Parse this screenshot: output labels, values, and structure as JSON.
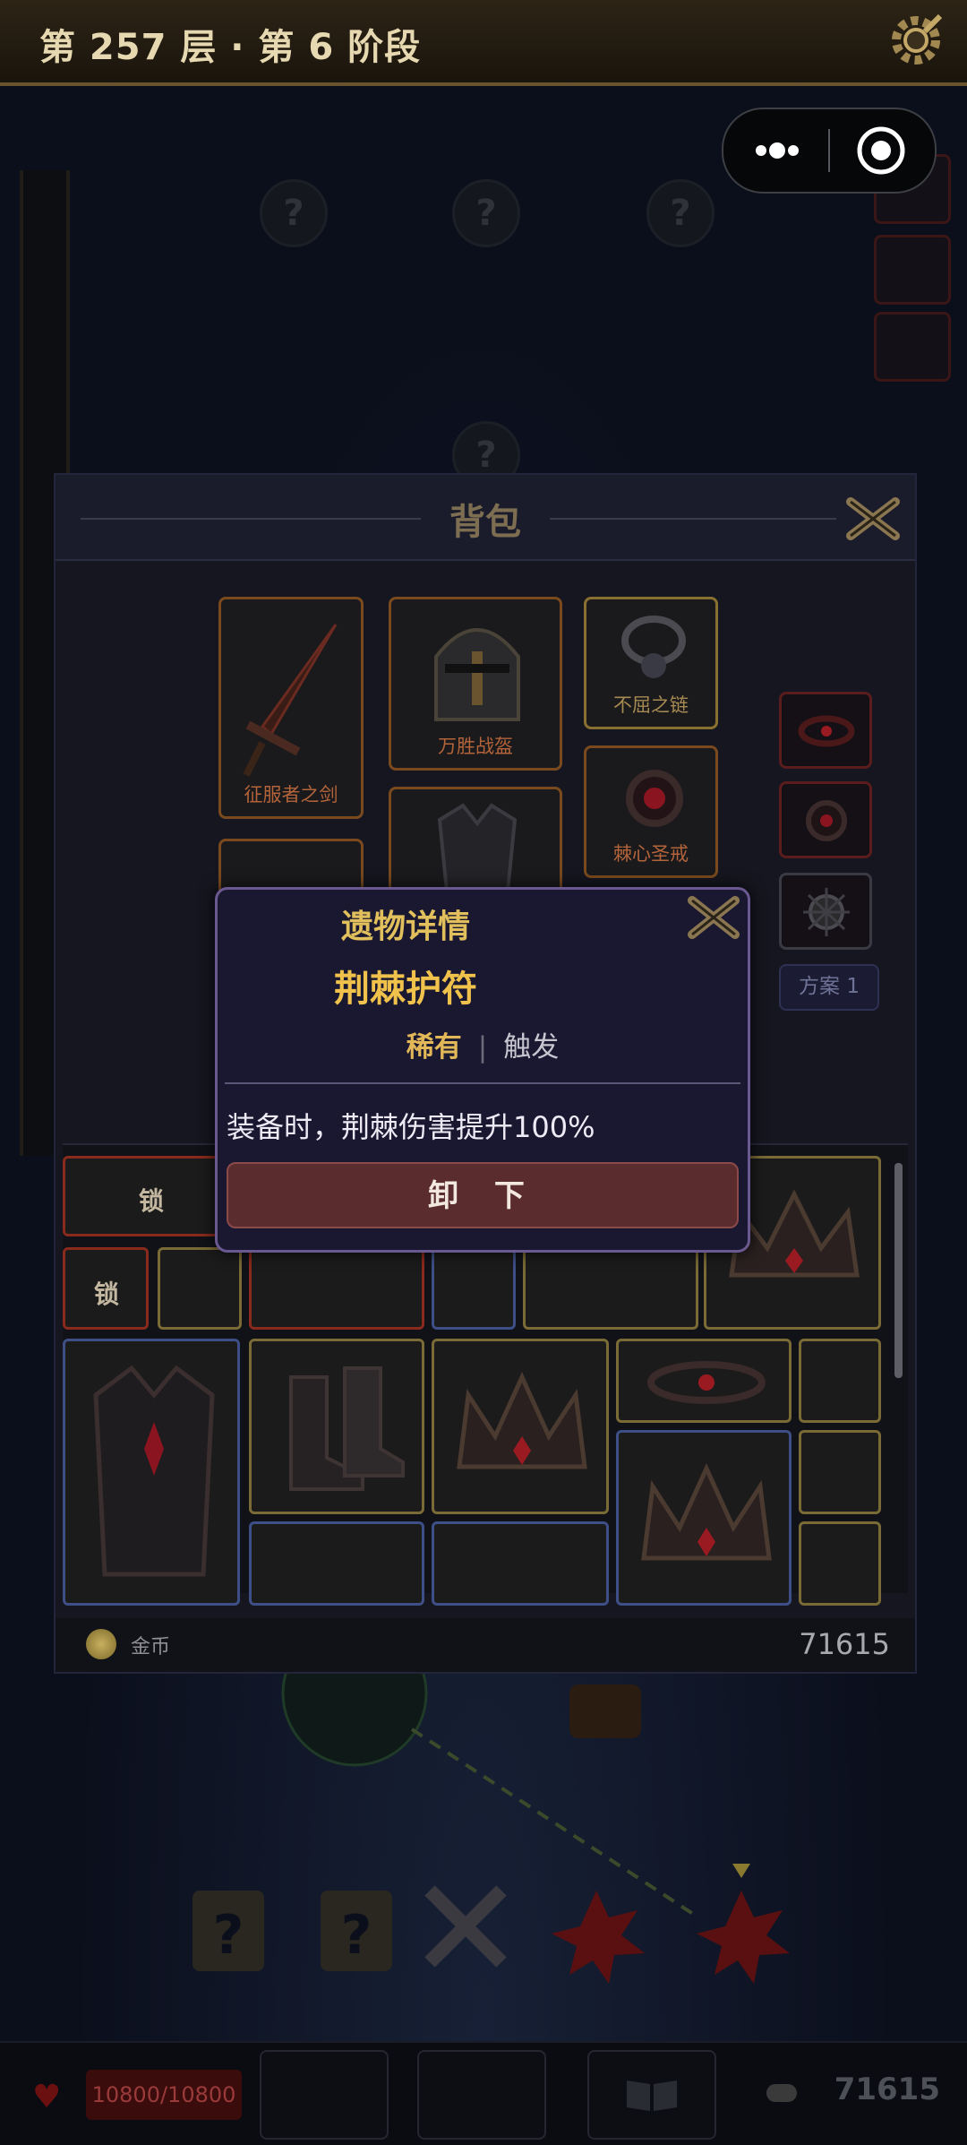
{
  "header": {
    "floor_title": "第 257 层 · 第 6 阶段"
  },
  "backpack": {
    "title": "背包",
    "equipped": [
      {
        "name": "征服者之剑"
      },
      {
        "name": "万胜战盔"
      },
      {
        "name": "不屈之链"
      },
      {
        "name": "棘心圣戒"
      }
    ],
    "preset_label": "方案 1",
    "inventory": {
      "lock_label_1": "锁",
      "lock_label_2": "锁"
    },
    "currency_label": "金币",
    "currency_value": "71615"
  },
  "relic_dialog": {
    "title": "遗物详情",
    "name": "荆棘护符",
    "rarity": "稀有",
    "separator": "|",
    "type": "触发",
    "description": "装备时，荆棘伤害提升100%",
    "unequip_label": "卸 下"
  },
  "bottom_bar": {
    "hp": "10800/10800",
    "gold": "71615"
  },
  "colors": {
    "accent_gold": "#f0c24c",
    "dialog_bg": "#1a1830",
    "button_red": "#5a2c2e"
  }
}
